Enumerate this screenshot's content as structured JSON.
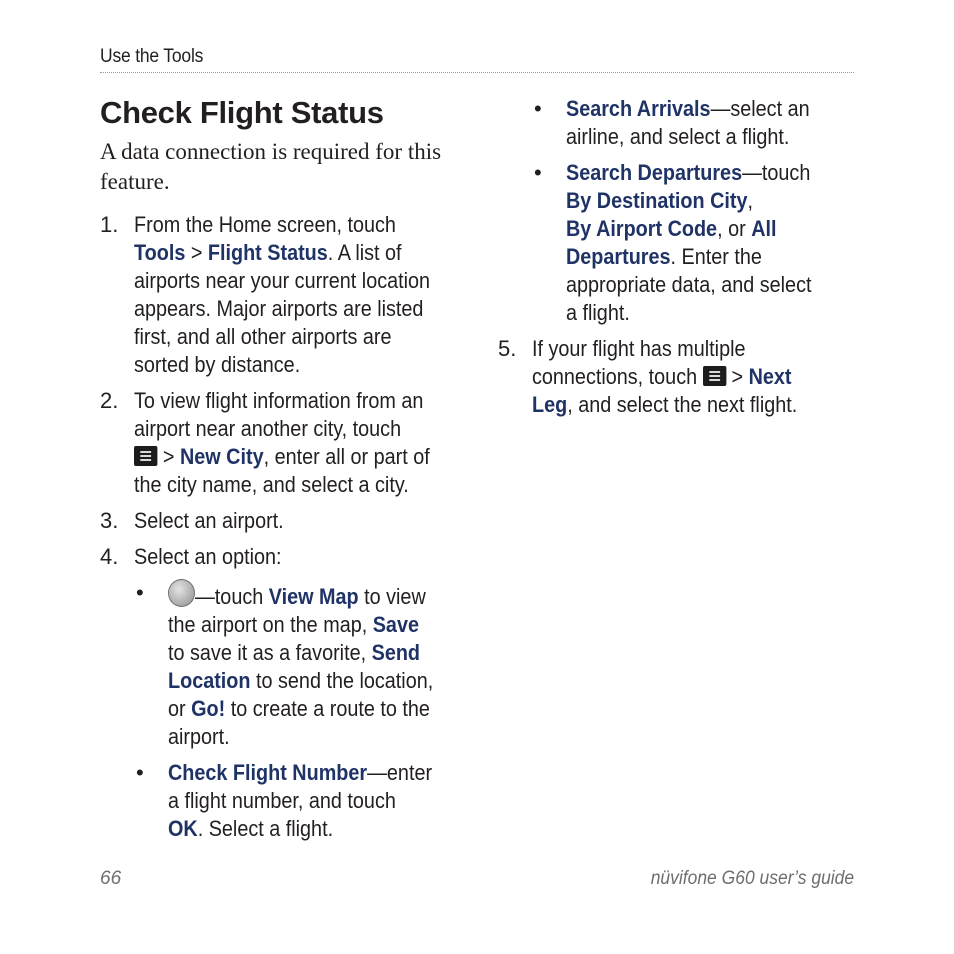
{
  "header": {
    "running_head": "Use the Tools"
  },
  "title": "Check Flight Status",
  "intro": [
    "A data connection is required for this",
    "feature."
  ],
  "steps": {
    "s1": {
      "num": "1.",
      "l1": "From the Home screen, touch",
      "tools": "Tools",
      "sep": " > ",
      "flight_status": "Flight Status",
      "l2_rest": ". A list of",
      "l3": "airports near your current location",
      "l4": "appears. Major airports are listed",
      "l5": "first, and all other airports are",
      "l6": "sorted by distance."
    },
    "s2": {
      "num": "2.",
      "l1": "To view flight information from an",
      "l2": "airport near another city, touch",
      "sep": " > ",
      "new_city": "New City",
      "l3_rest": ", enter all or part of",
      "l4": "the city name, and select a city."
    },
    "s3": {
      "num": "3.",
      "text": "Select an airport."
    },
    "s4": {
      "num": "4.",
      "text": "Select an option:"
    },
    "opt_pin": {
      "dot": "•",
      "a": "—touch ",
      "view_map": "View Map",
      "b": " to view",
      "l2a": "the airport on the map, ",
      "save": "Save",
      "l3a": "to save it as a favorite, ",
      "send": "Send",
      "location": "Location",
      "l4b": " to send the location,",
      "l5a": "or ",
      "go": "Go!",
      "l5b": " to create a route to the",
      "l6": "airport."
    },
    "opt_check": {
      "dot": "•",
      "label": "Check Flight Number",
      "a": "—enter",
      "l2": "a flight number, and touch",
      "ok": "OK",
      "l3b": ". Select a flight."
    },
    "opt_arrivals": {
      "dot": "•",
      "label": "Search Arrivals",
      "a": "—select an",
      "l2": "airline, and select a flight."
    },
    "opt_departures": {
      "dot": "•",
      "label": "Search Departures",
      "a": "—touch",
      "by_city": "By Destination City",
      "comma": ",",
      "by_code": "By Airport Code",
      "or": ", or ",
      "all": "All",
      "departures": "Departures",
      "l4b": ". Enter the",
      "l5": "appropriate data, and select",
      "l6": "a flight."
    },
    "s5": {
      "num": "5.",
      "l1": "If your flight has multiple",
      "l2a": "connections, touch ",
      "sep": " > ",
      "next": "Next",
      "leg": "Leg",
      "l3b": ", and select the next flight."
    }
  },
  "icons": {
    "menu": "menu-icon",
    "pin": "pushpin-icon"
  },
  "colors": {
    "link": "#1f3366",
    "text": "#231f20",
    "footer": "#6d6e71"
  },
  "footer": {
    "page_number": "66",
    "guide_title": "nüvifone G60 user’s guide"
  }
}
